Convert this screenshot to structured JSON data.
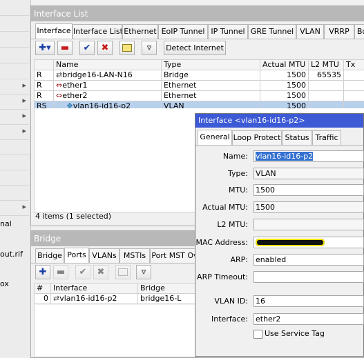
{
  "left_strip": {
    "labels": [
      "nal",
      "out.rif",
      "ox"
    ]
  },
  "interface_list": {
    "title": "Interface List",
    "tabs": [
      "Interface",
      "Interface List",
      "Ethernet",
      "EoIP Tunnel",
      "IP Tunnel",
      "GRE Tunnel",
      "VLAN",
      "VRRP",
      "Bo"
    ],
    "toolbar": {
      "detect_internet": "Detect Internet"
    },
    "columns": [
      "",
      "Name",
      "Type",
      "Actual MTU",
      "L2 MTU",
      "Tx"
    ],
    "rows": [
      {
        "flag": "R",
        "name": "bridge16-LAN-N16",
        "type": "Bridge",
        "mtu": "1500",
        "l2mtu": "65535"
      },
      {
        "flag": "R",
        "name": "ether1",
        "type": "Ethernet",
        "mtu": "1500",
        "l2mtu": ""
      },
      {
        "flag": "R",
        "name": "ether2",
        "type": "Ethernet",
        "mtu": "1500",
        "l2mtu": ""
      },
      {
        "flag": "RS",
        "name": "vlan16-id16-p2",
        "type": "VLAN",
        "mtu": "1500",
        "l2mtu": ""
      }
    ],
    "status": "4 items (1 selected)"
  },
  "bridge": {
    "title": "Bridge",
    "tabs": [
      "Bridge",
      "Ports",
      "VLANs",
      "MSTIs",
      "Port MST Ov"
    ],
    "columns": [
      "#",
      "Interface",
      "Bridge"
    ],
    "rows": [
      {
        "num": "0",
        "interface": "vlan16-id16-p2",
        "bridge": "bridge16-L"
      }
    ]
  },
  "dialog": {
    "title": "Interface <vlan16-id16-p2>",
    "tabs": [
      "General",
      "Loop Protect",
      "Status",
      "Traffic"
    ],
    "fields": {
      "name_label": "Name:",
      "name_value": "vlan16-id16-p2",
      "type_label": "Type:",
      "type_value": "VLAN",
      "mtu_label": "MTU:",
      "mtu_value": "1500",
      "actual_mtu_label": "Actual MTU:",
      "actual_mtu_value": "1500",
      "l2mtu_label": "L2 MTU:",
      "l2mtu_value": "",
      "mac_label": "MAC Address:",
      "arp_label": "ARP:",
      "arp_value": "enabled",
      "arp_timeout_label": "ARP Timeout:",
      "arp_timeout_value": "",
      "vlan_id_label": "VLAN ID:",
      "vlan_id_value": "16",
      "interface_label": "Interface:",
      "interface_value": "ether2",
      "service_tag_label": "Use Service Tag"
    }
  },
  "colors": {
    "dialog_title": "#3c5ad6",
    "selection": "#b8d0ec",
    "redaction": "#f0e000"
  }
}
